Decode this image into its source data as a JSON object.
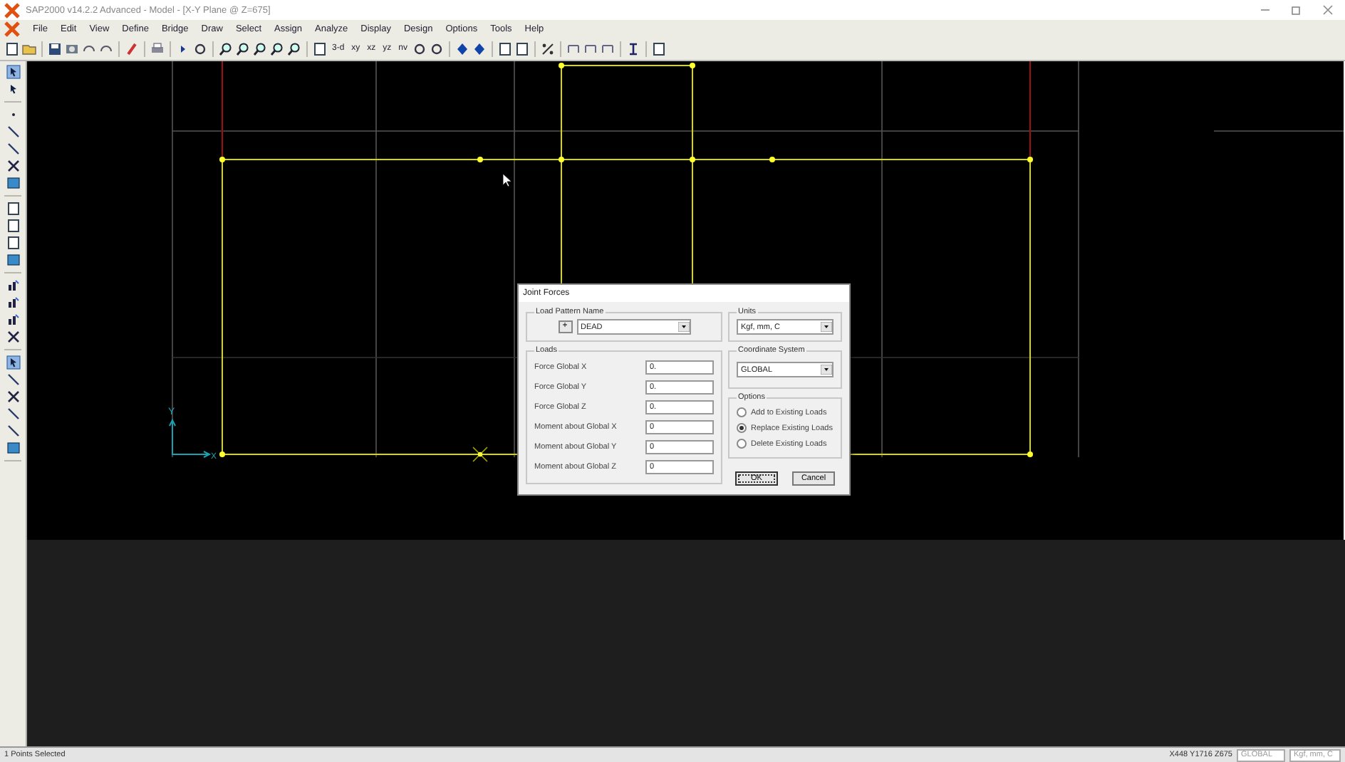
{
  "window": {
    "title": "SAP2000 v14.2.2 Advanced  - Model - [X-Y Plane @ Z=675]"
  },
  "menu": [
    "File",
    "Edit",
    "View",
    "Define",
    "Bridge",
    "Draw",
    "Select",
    "Assign",
    "Analyze",
    "Display",
    "Design",
    "Options",
    "Tools",
    "Help"
  ],
  "toolbar": {
    "view_buttons": [
      "3-d",
      "xy",
      "xz",
      "yz",
      "nv"
    ]
  },
  "canvas": {
    "axis_labels": [
      "Y",
      "X"
    ]
  },
  "dialog": {
    "title": "Joint Forces",
    "load_pattern": {
      "label": "Load Pattern Name",
      "add_button": "+",
      "value": "DEAD"
    },
    "units": {
      "label": "Units",
      "value": "Kgf, mm, C"
    },
    "loads": {
      "label": "Loads",
      "rows": [
        {
          "label": "Force Global X",
          "value": "0."
        },
        {
          "label": "Force Global Y",
          "value": "0."
        },
        {
          "label": "Force Global Z",
          "value": "0."
        },
        {
          "label": "Moment about Global X",
          "value": "0"
        },
        {
          "label": "Moment about Global Y",
          "value": "0"
        },
        {
          "label": "Moment about Global Z",
          "value": "0"
        }
      ]
    },
    "coordinate_system": {
      "label": "Coordinate System",
      "value": "GLOBAL"
    },
    "options": {
      "label": "Options",
      "items": [
        {
          "label": "Add to Existing Loads",
          "selected": false
        },
        {
          "label": "Replace Existing Loads",
          "selected": true
        },
        {
          "label": "Delete Existing Loads",
          "selected": false
        }
      ]
    },
    "buttons": [
      "OK",
      "Cancel"
    ]
  },
  "status_bar": {
    "message": "1 Points Selected",
    "coordinates": "X448 Y1716 Z675",
    "coordinate_system": "GLOBAL",
    "units": "Kgf, mm, C"
  }
}
